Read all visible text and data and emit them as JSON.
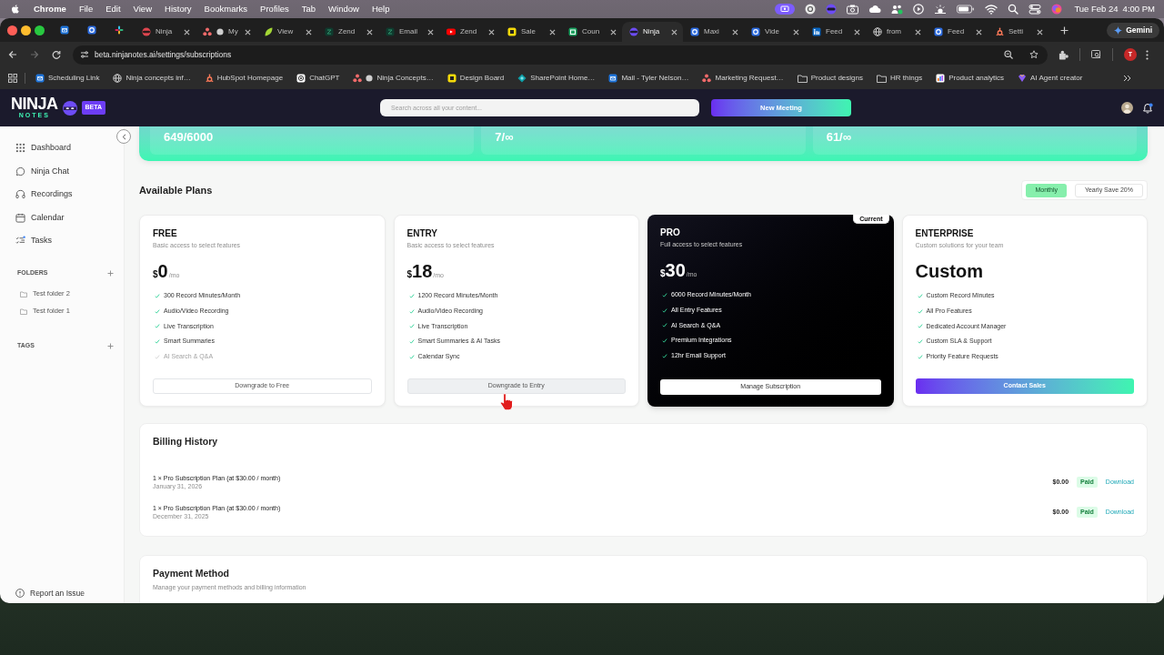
{
  "menu_bar": {
    "app_name": "Chrome",
    "menus": [
      "File",
      "Edit",
      "View",
      "History",
      "Bookmarks",
      "Profiles",
      "Tab",
      "Window",
      "Help"
    ],
    "date": "Tue Feb 24",
    "time": "4:00 PM"
  },
  "browser": {
    "tabs": [
      {
        "title": "Ninja",
        "selected": false
      },
      {
        "title": "My",
        "selected": false
      },
      {
        "title": "View",
        "selected": false
      },
      {
        "title": "Zend",
        "selected": false
      },
      {
        "title": "Email",
        "selected": false
      },
      {
        "title": "Zend",
        "selected": false
      },
      {
        "title": "Sale",
        "selected": false
      },
      {
        "title": "Coun",
        "selected": false
      },
      {
        "title": "Ninja",
        "selected": true
      },
      {
        "title": "Maxi",
        "selected": false
      },
      {
        "title": "Vide",
        "selected": false
      },
      {
        "title": "Feed",
        "selected": false
      },
      {
        "title": "from",
        "selected": false
      },
      {
        "title": "Feed",
        "selected": false
      },
      {
        "title": "Setti",
        "selected": false
      }
    ],
    "gemini_button": "Gemini",
    "address": "beta.ninjanotes.ai/settings/subscriptions",
    "profile_initial": "T",
    "bookmarks": [
      {
        "label": "Scheduling Link",
        "kind": "link"
      },
      {
        "label": "Ninja concepts inf…",
        "kind": "link"
      },
      {
        "label": "HubSpot Homepage",
        "kind": "link"
      },
      {
        "label": "ChatGPT",
        "kind": "link"
      },
      {
        "label": "Ninja Concepts…",
        "kind": "link"
      },
      {
        "label": "Design Board",
        "kind": "link"
      },
      {
        "label": "SharePoint Home…",
        "kind": "link"
      },
      {
        "label": "Mail - Tyler Nelson…",
        "kind": "link"
      },
      {
        "label": "Marketing Request…",
        "kind": "link"
      },
      {
        "label": "Product designs",
        "kind": "folder"
      },
      {
        "label": "HR things",
        "kind": "folder"
      },
      {
        "label": "Product analytics",
        "kind": "link"
      },
      {
        "label": "AI Agent creator",
        "kind": "link"
      }
    ]
  },
  "app": {
    "header": {
      "logo": "NINJA",
      "logo_tagline": "NOTES",
      "badge": "BETA",
      "search_placeholder": "Search across all your content...",
      "new_meeting_button": "New Meeting"
    },
    "sidebar": {
      "nav": [
        "Dashboard",
        "Ninja Chat",
        "Recordings",
        "Calendar",
        "Tasks"
      ],
      "folders_heading": "FOLDERS",
      "folders": [
        "Test folder 2",
        "Test folder 1"
      ],
      "tags_heading": "TAGS",
      "report_link": "Report an Issue"
    },
    "usage": [
      "649/6000",
      "7/∞",
      "61/∞"
    ],
    "plans_section": {
      "title": "Available Plans",
      "billing_periods": [
        {
          "label": "Monthly",
          "selected": true
        },
        {
          "label": "Yearly Save 20%",
          "selected": false
        }
      ],
      "plans": [
        {
          "name": "FREE",
          "description": "Basic access to select features",
          "price": {
            "currency": "$",
            "amount": "0",
            "period": "/mo"
          },
          "current": false,
          "features": [
            {
              "text": "300 Record Minutes/Month",
              "included": true
            },
            {
              "text": "Audio/Video Recording",
              "included": true
            },
            {
              "text": "Live Transcription",
              "included": true
            },
            {
              "text": "Smart Summaries",
              "included": true
            },
            {
              "text": "AI Search & Q&A",
              "included": false
            }
          ],
          "button": {
            "label": "Downgrade to Free",
            "kind": "downgrade",
            "hovered": false
          }
        },
        {
          "name": "ENTRY",
          "description": "Basic access to select features",
          "price": {
            "currency": "$",
            "amount": "18",
            "period": "/mo"
          },
          "current": false,
          "features": [
            {
              "text": "1200 Record Minutes/Month",
              "included": true
            },
            {
              "text": "Audio/Video Recording",
              "included": true
            },
            {
              "text": "Live Transcription",
              "included": true
            },
            {
              "text": "Smart Summaries & AI Tasks",
              "included": true
            },
            {
              "text": "Calendar Sync",
              "included": true
            }
          ],
          "button": {
            "label": "Downgrade to Entry",
            "kind": "downgrade",
            "hovered": true
          }
        },
        {
          "name": "PRO",
          "description": "Full access to select features",
          "price": {
            "currency": "$",
            "amount": "30",
            "period": "/mo"
          },
          "current": true,
          "badge": "Current",
          "features": [
            {
              "text": "6000 Record Minutes/Month",
              "included": true
            },
            {
              "text": "All Entry Features",
              "included": true
            },
            {
              "text": "AI Search & Q&A",
              "included": true
            },
            {
              "text": "Premium Integrations",
              "included": true
            },
            {
              "text": "12hr Email Support",
              "included": true
            }
          ],
          "button": {
            "label": "Manage Subscription",
            "kind": "manage",
            "hovered": false
          }
        },
        {
          "name": "ENTERPRISE",
          "description": "Custom solutions for your team",
          "price": {
            "amount": "Custom"
          },
          "current": false,
          "features": [
            {
              "text": "Custom Record Minutes",
              "included": true
            },
            {
              "text": "All Pro Features",
              "included": true
            },
            {
              "text": "Dedicated Account Manager",
              "included": true
            },
            {
              "text": "Custom SLA & Support",
              "included": true
            },
            {
              "text": "Priority Feature Requests",
              "included": true
            }
          ],
          "button": {
            "label": "Contact Sales",
            "kind": "contact",
            "hovered": false
          }
        }
      ]
    },
    "billing_history": {
      "title": "Billing History",
      "rows": [
        {
          "description": "1 × Pro Subscription Plan (at $30.00 / month)",
          "date": "January 31, 2026",
          "amount": "$0.00",
          "status": "Paid",
          "action": "Download"
        },
        {
          "description": "1 × Pro Subscription Plan (at $30.00 / month)",
          "date": "December 31, 2025",
          "amount": "$0.00",
          "status": "Paid",
          "action": "Download"
        }
      ]
    },
    "payment_method": {
      "title": "Payment Method",
      "subtitle": "Manage your payment methods and billing information"
    }
  }
}
